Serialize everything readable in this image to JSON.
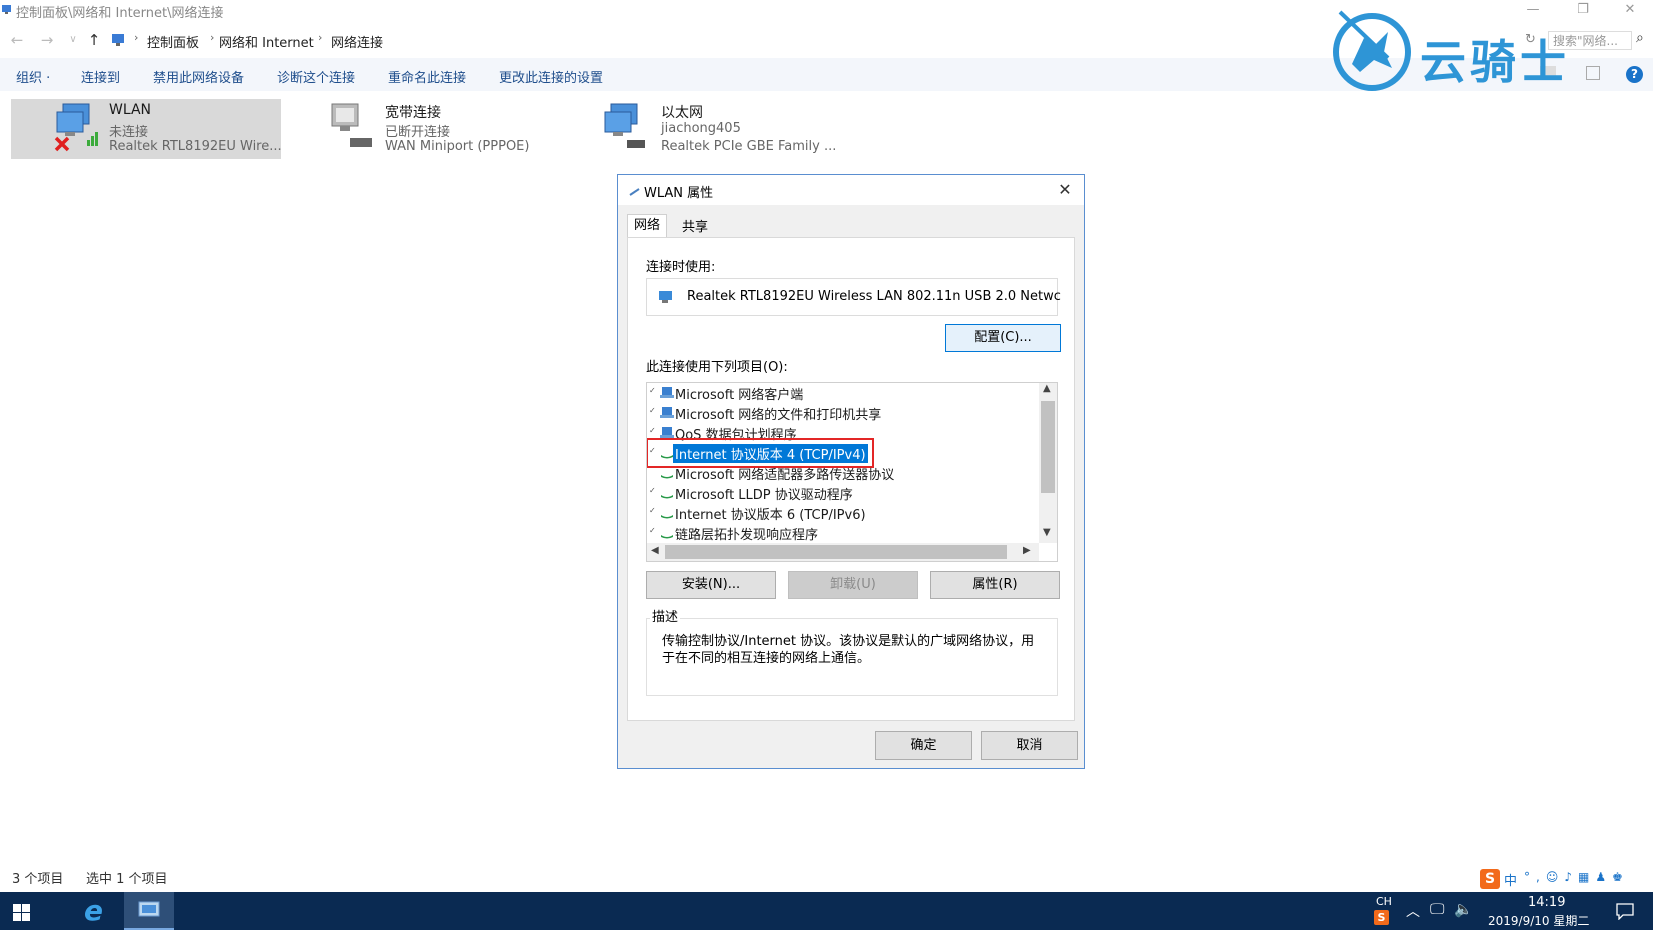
{
  "window": {
    "title": "控制面板\\网络和 Internet\\网络连接",
    "minimize": "—",
    "maximize": "❐",
    "close": "✕"
  },
  "address": {
    "crumbs": [
      "控制面板",
      "网络和 Internet",
      "网络连接"
    ],
    "search_placeholder": "搜索\"网络..."
  },
  "toolbar": {
    "items": [
      "组织 ·",
      "连接到",
      "禁用此网络设备",
      "诊断这个连接",
      "重命名此连接",
      "更改此连接的设置"
    ],
    "help": "?"
  },
  "connections": [
    {
      "name": "WLAN",
      "status": "未连接",
      "device": "Realtek RTL8192EU Wire..."
    },
    {
      "name": "宽带连接",
      "status": "已断开连接",
      "device": "WAN Miniport (PPPOE)"
    },
    {
      "name": "以太网",
      "status": "jiachong405",
      "device": "Realtek PCIe GBE Family ..."
    }
  ],
  "dialog": {
    "title": "WLAN 属性",
    "close": "✕",
    "tabs": [
      "网络",
      "共享"
    ],
    "connect_using_label": "连接时使用:",
    "adapter": "Realtek RTL8192EU Wireless LAN 802.11n USB 2.0 Netwc",
    "configure": "配置(C)...",
    "items_label": "此连接使用下列项目(O):",
    "items": [
      "Microsoft 网络客户端",
      "Microsoft 网络的文件和打印机共享",
      "QoS 数据包计划程序",
      "Internet 协议版本 4 (TCP/IPv4)",
      "Microsoft 网络适配器多路传送器协议",
      "Microsoft LLDP 协议驱动程序",
      "Internet 协议版本 6 (TCP/IPv6)",
      "链路层拓扑发现响应程序"
    ],
    "selected_index": 3,
    "install": "安装(N)...",
    "uninstall": "卸载(U)",
    "properties": "属性(R)",
    "desc_label": "描述",
    "desc_line1": "传输控制协议/Internet 协议。该协议是默认的广域网络协议，用",
    "desc_line2": "于在不同的相互连接的网络上通信。",
    "ok": "确定",
    "cancel": "取消"
  },
  "status": {
    "count": "3 个项目",
    "selected": "选中 1 个项目"
  },
  "taskbar": {
    "lang": "CH",
    "ime": "中",
    "time": "14:19",
    "date": "2019/9/10 星期二"
  },
  "watermark": {
    "text": "云骑士"
  },
  "colors": {
    "selection": "#0078d7",
    "highlight_box": "#e32626",
    "taskbar": "#0a2a52",
    "accent": "#2e95d6"
  }
}
